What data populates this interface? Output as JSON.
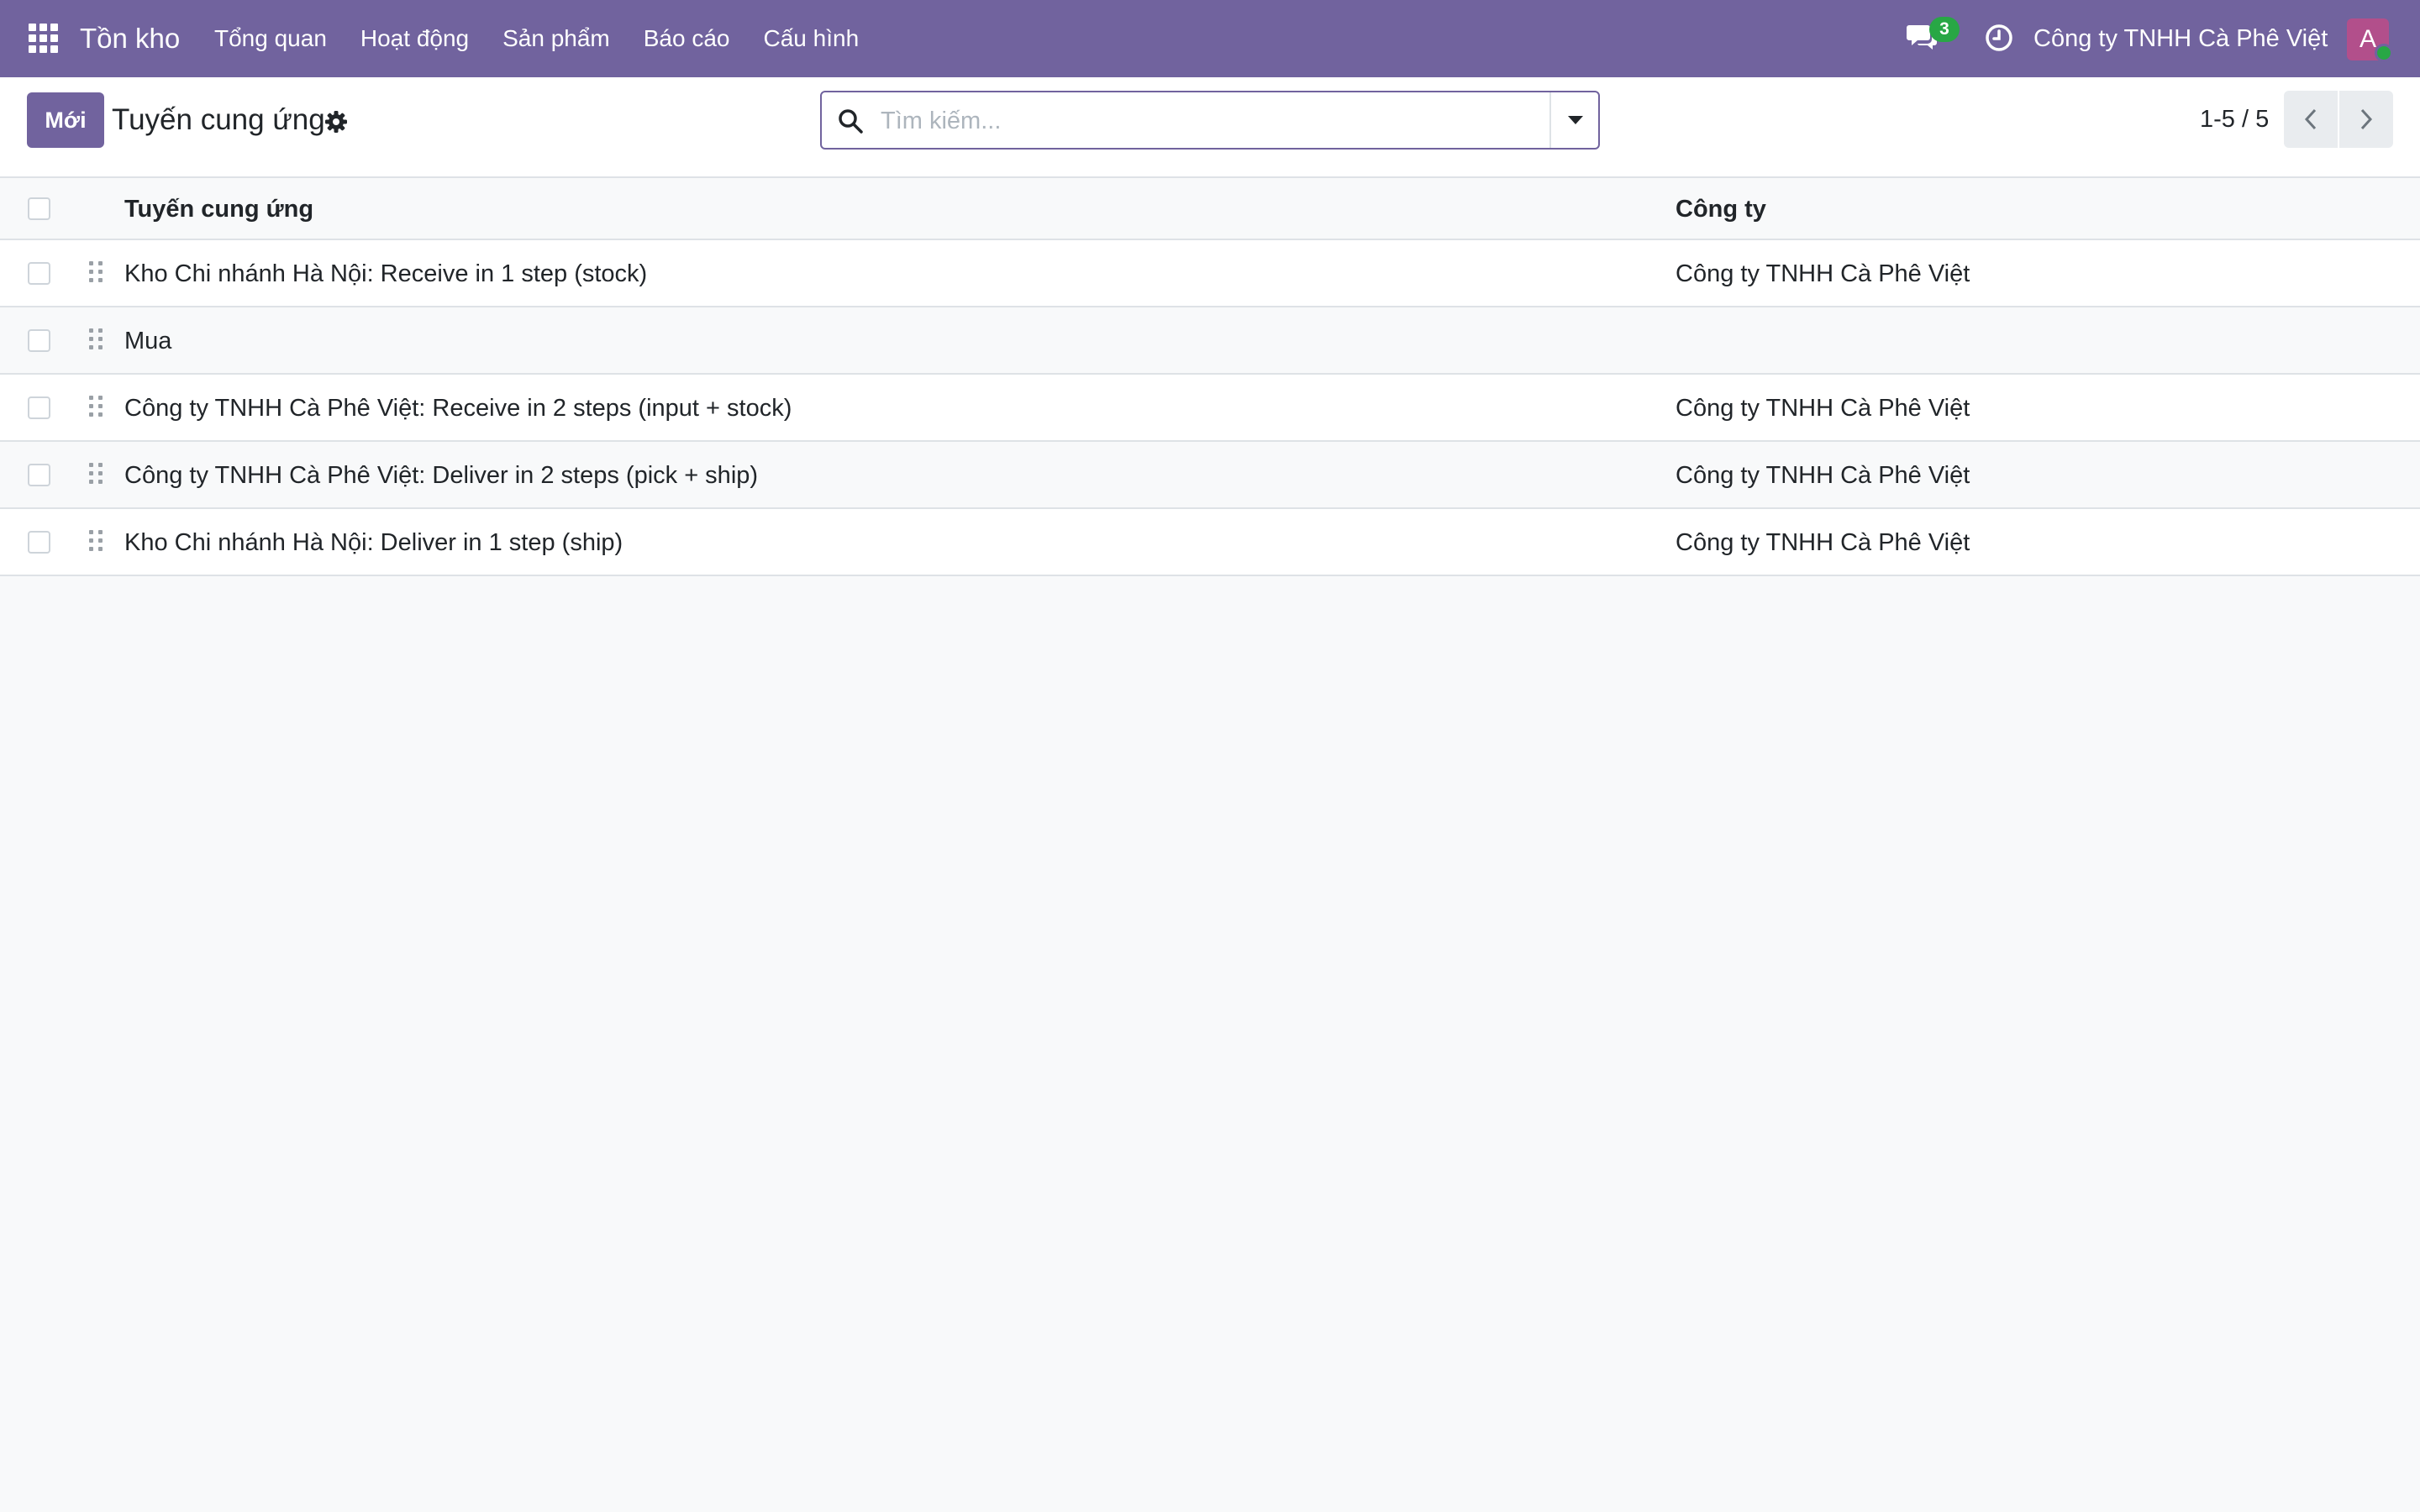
{
  "navbar": {
    "app_name": "Tồn kho",
    "menu": [
      "Tổng quan",
      "Hoạt động",
      "Sản phẩm",
      "Báo cáo",
      "Cấu hình"
    ],
    "messages_count": "3",
    "company": "Công ty TNHH Cà Phê Việt",
    "avatar_letter": "A",
    "colors": {
      "primary": "#71639e",
      "badge": "#28a745",
      "avatar": "#b24f8b"
    }
  },
  "control_panel": {
    "new_label": "Mới",
    "title": "Tuyến cung ứng",
    "search_placeholder": "Tìm kiếm...",
    "pager": "1-5 / 5"
  },
  "table": {
    "columns": [
      "Tuyến cung ứng",
      "Công ty"
    ],
    "rows": [
      {
        "name": "Kho Chi nhánh Hà Nội: Receive in 1 step (stock)",
        "company": "Công ty TNHH Cà Phê Việt"
      },
      {
        "name": "Mua",
        "company": ""
      },
      {
        "name": "Công ty TNHH Cà Phê Việt: Receive in 2 steps (input + stock)",
        "company": "Công ty TNHH Cà Phê Việt"
      },
      {
        "name": "Công ty TNHH Cà Phê Việt: Deliver in 2 steps (pick + ship)",
        "company": "Công ty TNHH Cà Phê Việt"
      },
      {
        "name": "Kho Chi nhánh Hà Nội: Deliver in 1 step (ship)",
        "company": "Công ty TNHH Cà Phê Việt"
      }
    ]
  }
}
